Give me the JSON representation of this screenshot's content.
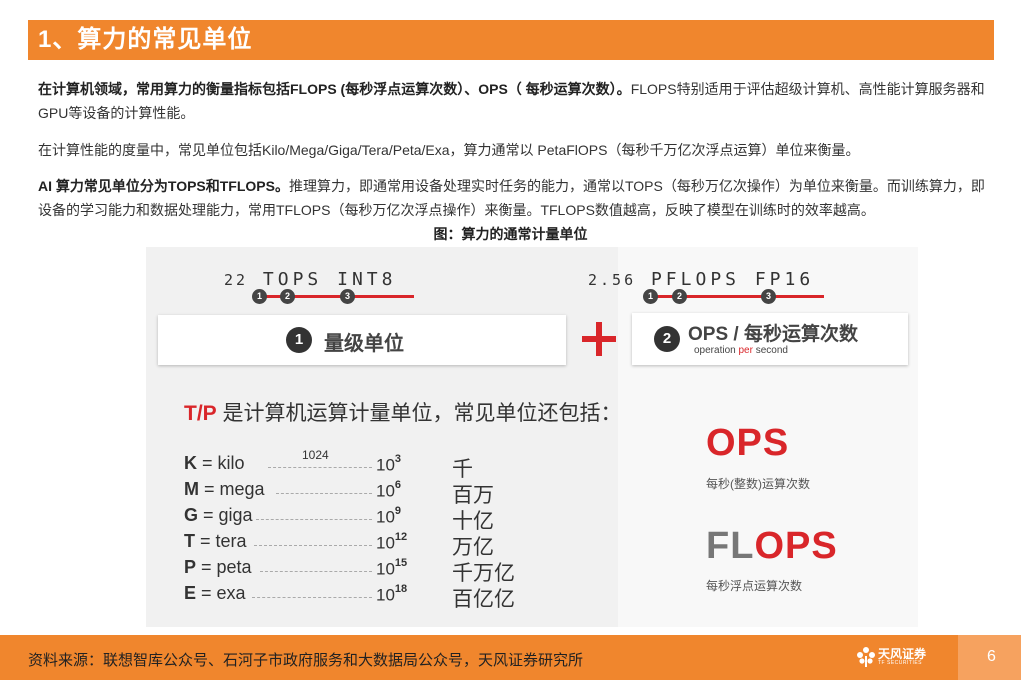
{
  "title": "1、算力的常见单位",
  "paragraphs": {
    "p1_bold": "在计算机领域，常用算力的衡量指标包括FLOPS (每秒浮点运算次数）、OPS（ 每秒运算次数）。",
    "p1_rest": "FLOPS特别适用于评估超级计算机、高性能计算服务器和GPU等设备的计算性能。",
    "p2": "在计算性能的度量中，常见单位包括Kilo/Mega/Giga/Tera/Peta/Exa，算力通常以 PetaFlOPS（每秒千万亿次浮点运算）单位来衡量。",
    "p3_bold": "AI 算力常见单位分为TOPS和TFLOPS。",
    "p3_rest": "推理算力，即通常用设备处理实时任务的能力，通常以TOPS（每秒万亿次操作）为单位来衡量。而训练算力，即设备的学习能力和数据处理能力，常用TFLOPS（每秒万亿次浮点操作）来衡量。TFLOPS数值越高，反映了模型在训练时的效率越高。"
  },
  "caption": "图：算力的通常计量单位",
  "figure": {
    "left_code": {
      "num": "22",
      "unit": "TOPS",
      "type": "INT8",
      "markers": [
        "1",
        "2",
        "3"
      ]
    },
    "right_code": {
      "num": "2.56",
      "unit": "PFLOPS",
      "type": "FP16",
      "markers": [
        "1",
        "2",
        "3"
      ]
    },
    "box1": {
      "num": "1",
      "label": "量级单位"
    },
    "box2": {
      "num": "2",
      "label": "OPS / 每秒运算次数",
      "sub_prefix": "operation ",
      "sub_highlight": "per",
      "sub_suffix": " second"
    },
    "tp_prefix": "T/P",
    "tp_rest": " 是计算机运算计量单位，常见单位还包括：",
    "annotation_1024": "1024",
    "units": [
      {
        "letter": "K",
        "name": " = kilo",
        "base": "10",
        "exp": "3",
        "zh": "千"
      },
      {
        "letter": "M",
        "name": " = mega",
        "base": "10",
        "exp": "6",
        "zh": "百万"
      },
      {
        "letter": "G",
        "name": " = giga",
        "base": "10",
        "exp": "9",
        "zh": "十亿"
      },
      {
        "letter": "T",
        "name": " = tera",
        "base": "10",
        "exp": "12",
        "zh": "万亿"
      },
      {
        "letter": "P",
        "name": " = peta",
        "base": "10",
        "exp": "15",
        "zh": "千万亿"
      },
      {
        "letter": "E",
        "name": " = exa",
        "base": "10",
        "exp": "18",
        "zh": "百亿亿"
      }
    ],
    "ops_big": "OPS",
    "ops_sub": "每秒(整数)运算次数",
    "flops_fl": "FL",
    "flops_ops": "OPS",
    "flops_sub": "每秒浮点运算次数"
  },
  "footer": {
    "source": "资料来源：联想智库公众号、石河子市政府服务和大数据局公众号，天风证券研究所",
    "logo_text": "天风证券",
    "logo_sub": "TF SECURITIES",
    "page": "6"
  },
  "colors": {
    "accent": "#f0862d",
    "red": "#d9262a"
  }
}
